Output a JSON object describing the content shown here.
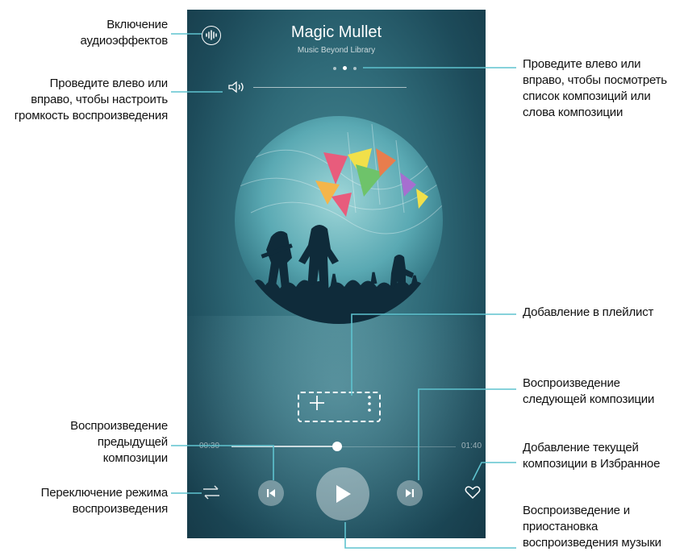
{
  "player": {
    "track_title": "Magic Mullet",
    "album": "Music Beyond Library",
    "time_elapsed": "00:30",
    "time_total": "01:40",
    "progress": 0.47,
    "page_dots": 3,
    "active_dot": 1
  },
  "callouts": {
    "effects": "Включение аудиоэффектов",
    "volume": "Проведите влево или вправо, чтобы настроить громкость воспроизведения",
    "swipe": "Проведите влево или вправо, чтобы посмотреть список композиций или слова композиции",
    "playlist": "Добавление в плейлист",
    "next": "Воспроизведение следующей композиции",
    "previous": "Воспроизведение предыдущей композиции",
    "favorite": "Добавление текущей композиции в Избранное",
    "mode": "Переключение режима воспроизведения",
    "play_pause": "Воспроизведение и приостановка воспроизведения музыки"
  },
  "icons": {
    "effects": "audio-effects-icon",
    "volume": "volume-icon",
    "add": "plus-icon",
    "more": "more-vertical-icon",
    "previous": "skip-previous-icon",
    "play": "play-icon",
    "next": "skip-next-icon",
    "repeat": "shuffle-repeat-icon",
    "favorite": "heart-icon"
  },
  "colors": {
    "accent_line": "#5fc3cf",
    "screen_bg": "#2f6a78"
  }
}
